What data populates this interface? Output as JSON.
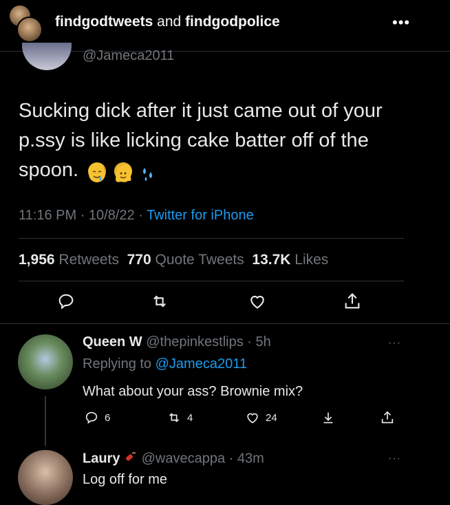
{
  "header": {
    "account1": "findgodtweets",
    "and_text": "and",
    "account2": "findgodpolice",
    "more": "•••"
  },
  "tweet": {
    "handle": "@Jameca2011",
    "text": "Sucking dick after it just came out of your p.ssy is like licking cake batter off of the spoon.",
    "emoji_icons": [
      "drooling-face-icon",
      "melting-face-icon",
      "sweat-droplets-icon"
    ],
    "time": "11:16 PM",
    "date": "10/8/22",
    "source": "Twitter for iPhone",
    "retweets_count": "1,956",
    "retweets_label": "Retweets",
    "quotes_count": "770",
    "quotes_label": "Quote Tweets",
    "likes_count": "13.7K",
    "likes_label": "Likes"
  },
  "replies": [
    {
      "name": "Queen W",
      "handle": "@thepinkestlips",
      "time": "5h",
      "replying_prefix": "Replying to",
      "replying_to": "@Jameca2011",
      "text": "What about your ass? Brownie mix?",
      "reply_count": "6",
      "retweet_count": "4",
      "like_count": "24",
      "more": "···"
    },
    {
      "name": "Laury",
      "handle": "@wavecappa",
      "time": "43m",
      "text": "Log off for me",
      "more": "···"
    }
  ],
  "colors": {
    "accent": "#1d9bf0",
    "muted": "#71767b",
    "text": "#e7e9ea",
    "divider": "#2f3336"
  }
}
